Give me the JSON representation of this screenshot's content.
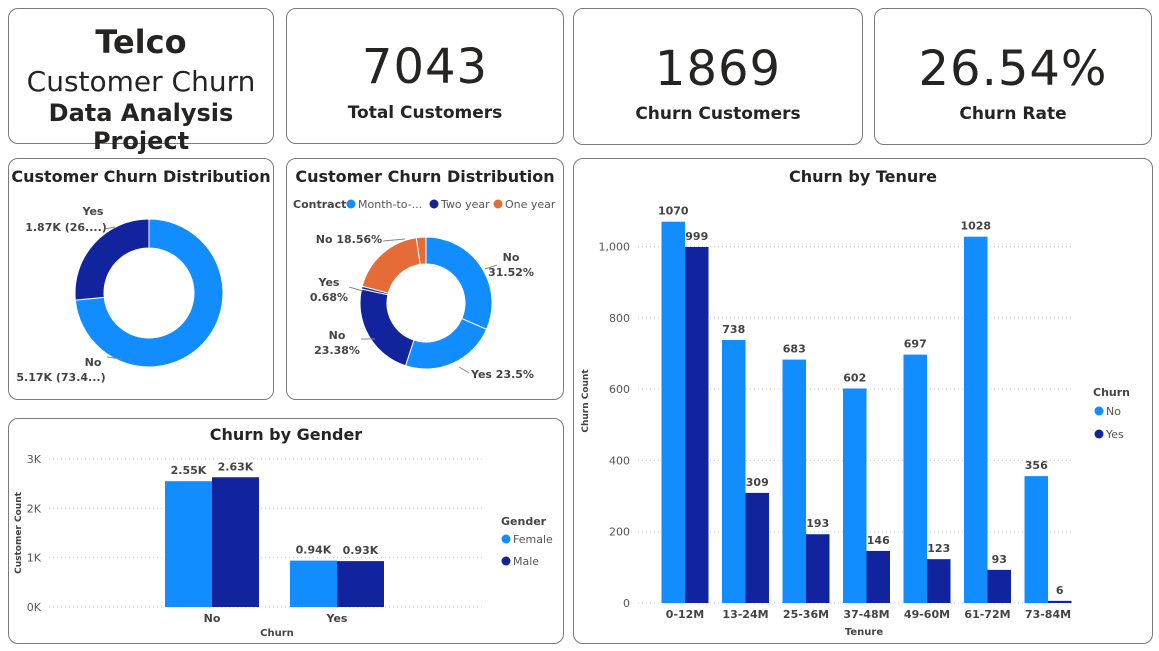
{
  "title_card": {
    "line1": "Telco",
    "line2": "Customer Churn",
    "line3": "Data Analysis Project"
  },
  "kpis": [
    {
      "value": "7043",
      "label": "Total Customers"
    },
    {
      "value": "1869",
      "label": "Churn Customers"
    },
    {
      "value": "26.54%",
      "label": "Churn Rate"
    }
  ],
  "colors": {
    "light_blue": "#118DFF",
    "dark_blue": "#12239E",
    "orange": "#E66C37"
  },
  "chart_data": [
    {
      "type": "pie",
      "title": "Customer Churn Distribution",
      "slices": [
        {
          "label": "No",
          "value": 5174,
          "display": "5.17K (73.4...)",
          "color": "#118DFF"
        },
        {
          "label": "Yes",
          "value": 1869,
          "display": "1.87K (26....)",
          "color": "#12239E"
        }
      ]
    },
    {
      "type": "pie",
      "title": "Customer Churn Distribution",
      "legend_title": "Contract",
      "legend": [
        {
          "label": "Month-to-...",
          "color": "#118DFF"
        },
        {
          "label": "Two year",
          "color": "#12239E"
        },
        {
          "label": "One year",
          "color": "#E66C37"
        }
      ],
      "slices": [
        {
          "label": "No",
          "value": 31.52,
          "display": "No 31.52%",
          "contract": "Month-to-month",
          "color": "#118DFF"
        },
        {
          "label": "Yes",
          "value": 23.5,
          "display": "Yes 23.5%",
          "contract": "Month-to-month",
          "color": "#118DFF"
        },
        {
          "label": "No",
          "value": 23.38,
          "display": "No 23.38%",
          "contract": "Two year",
          "color": "#12239E"
        },
        {
          "label": "Yes",
          "value": 0.68,
          "display": "Yes 0.68%",
          "contract": "Two year",
          "color": "#12239E"
        },
        {
          "label": "No",
          "value": 18.56,
          "display": "No 18.56%",
          "contract": "One year",
          "color": "#E66C37"
        },
        {
          "label": "Yes",
          "value": 2.36,
          "display": "",
          "contract": "One year",
          "color": "#E66C37"
        }
      ]
    },
    {
      "type": "bar",
      "title": "Churn by Gender",
      "xlabel": "Churn",
      "ylabel": "Customer Count",
      "categories": [
        "No",
        "Yes"
      ],
      "ylim": [
        0,
        3000
      ],
      "yticks": [
        0,
        1000,
        2000,
        3000
      ],
      "ytick_labels": [
        "0K",
        "1K",
        "2K",
        "3K"
      ],
      "legend_title": "Gender",
      "series": [
        {
          "name": "Female",
          "values": [
            2550,
            940
          ],
          "labels": [
            "2.55K",
            "0.94K"
          ],
          "color": "#118DFF"
        },
        {
          "name": "Male",
          "values": [
            2630,
            930
          ],
          "labels": [
            "2.63K",
            "0.93K"
          ],
          "color": "#12239E"
        }
      ]
    },
    {
      "type": "bar",
      "title": "Churn by Tenure",
      "xlabel": "Tenure",
      "ylabel": "Churn Count",
      "categories": [
        "0-12M",
        "13-24M",
        "25-36M",
        "37-48M",
        "49-60M",
        "61-72M",
        "73-84M"
      ],
      "ylim": [
        0,
        1100
      ],
      "yticks": [
        0,
        200,
        400,
        600,
        800,
        1000
      ],
      "ytick_labels": [
        "0",
        "200",
        "400",
        "600",
        "800",
        "1,000"
      ],
      "legend_title": "Churn",
      "series": [
        {
          "name": "No",
          "values": [
            1070,
            738,
            683,
            602,
            697,
            1028,
            356
          ],
          "color": "#118DFF"
        },
        {
          "name": "Yes",
          "values": [
            999,
            309,
            193,
            146,
            123,
            93,
            6
          ],
          "color": "#12239E"
        }
      ]
    }
  ]
}
